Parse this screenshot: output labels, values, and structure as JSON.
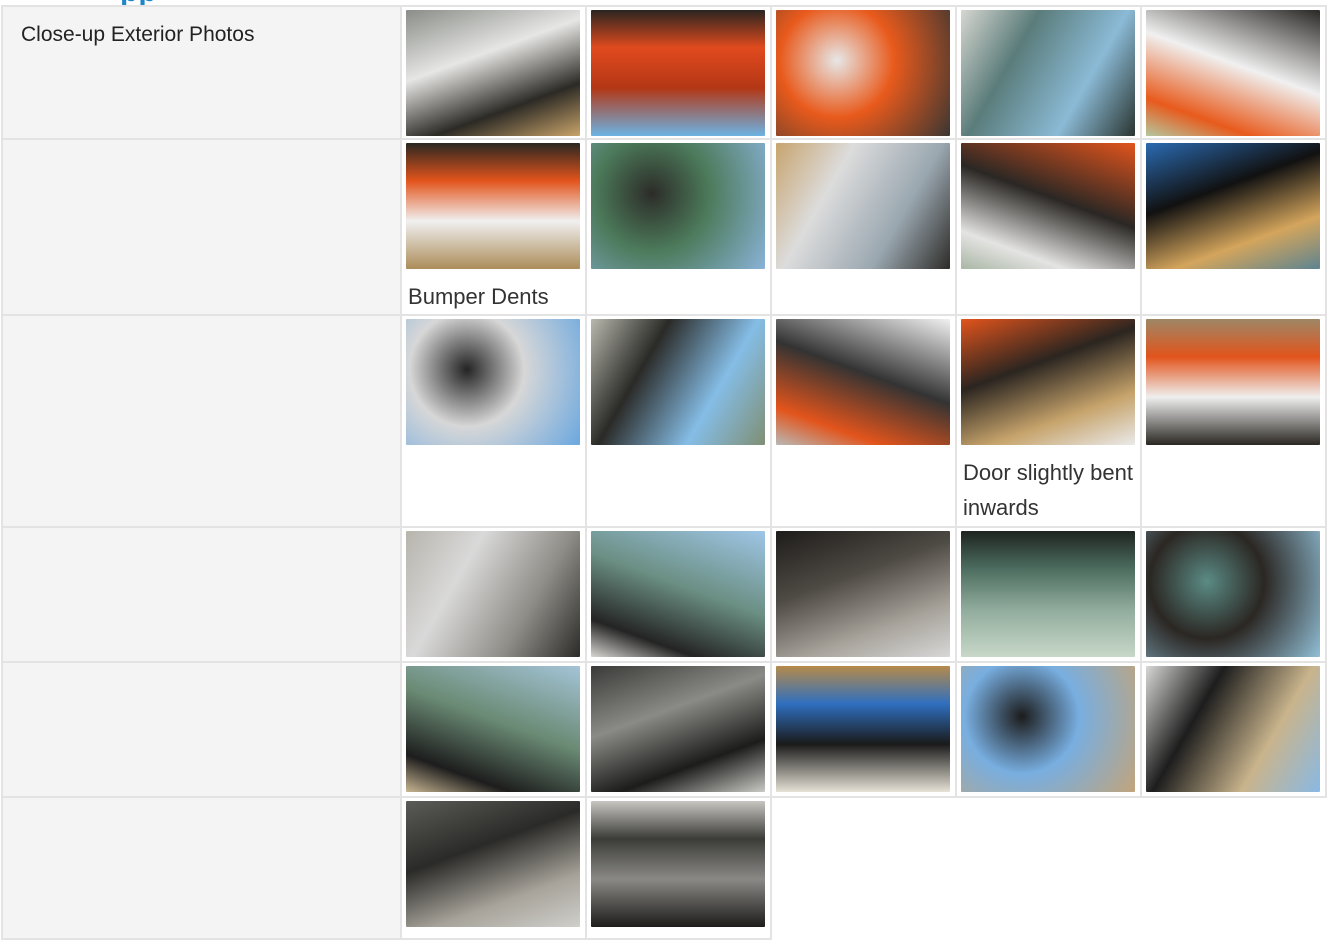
{
  "heading_fragment": "pp",
  "rows": [
    {
      "label": "Close-up Exterior Photos",
      "photos": [
        {
          "caption": "",
          "scene": "white-machine-track-side",
          "colors": [
            "#8a8d88",
            "#e6e6e4",
            "#2c2a25",
            "#c9a46a"
          ]
        },
        {
          "caption": "",
          "scene": "rear-door-open-radiator",
          "colors": [
            "#e14a1e",
            "#b33715",
            "#2a2420",
            "#6db3e3"
          ]
        },
        {
          "caption": "",
          "scene": "orange-rear-bobcat-logo",
          "colors": [
            "#e85a1c",
            "#e7e7e7",
            "#3a3632",
            "#d7ae70"
          ]
        },
        {
          "caption": "",
          "scene": "cab-glass-cage",
          "colors": [
            "#5a7c7a",
            "#2a3530",
            "#8bbad6",
            "#d6d6d0"
          ]
        },
        {
          "caption": "",
          "scene": "orange-side-bobcat-t870",
          "colors": [
            "#e85a1c",
            "#f0f0f0",
            "#2a2825",
            "#b4c7a0"
          ]
        }
      ]
    },
    {
      "label": "",
      "photos": [
        {
          "caption": "Bumper Dents",
          "scene": "rear-bumper-orange",
          "colors": [
            "#e2541c",
            "#f0f0f0",
            "#2a2620",
            "#ac8c59"
          ]
        },
        {
          "caption": "",
          "scene": "cab-side-trees",
          "colors": [
            "#4c7a5a",
            "#2c2c28",
            "#8ab3d8",
            "#bbbbb4"
          ]
        },
        {
          "caption": "",
          "scene": "lift-arm-track-white",
          "colors": [
            "#dcdcdc",
            "#2d2b28",
            "#9aa7b0",
            "#c7a46e"
          ]
        },
        {
          "caption": "",
          "scene": "side-panel-bobcat-t870",
          "colors": [
            "#e4e4e2",
            "#2a2724",
            "#e2541c",
            "#a9b6a5"
          ]
        },
        {
          "caption": "",
          "scene": "cab-front-lights-sky",
          "colors": [
            "#2b6bb2",
            "#111111",
            "#d4a55c",
            "#5d8490"
          ]
        }
      ]
    },
    {
      "label": "",
      "photos": [
        {
          "caption": "",
          "scene": "cab-roof-lift-arm",
          "colors": [
            "#d7d7d7",
            "#242424",
            "#6aa7df",
            "#c4a065"
          ]
        },
        {
          "caption": "",
          "scene": "cab-roof-hill",
          "colors": [
            "#2a2a27",
            "#7f8f74",
            "#85bde6",
            "#b8b8ae"
          ]
        },
        {
          "caption": "",
          "scene": "rear-lights-bobcat",
          "colors": [
            "#e2541c",
            "#333333",
            "#f1f1f1",
            "#b9b9b6"
          ]
        },
        {
          "caption": "Door slightly bent inwards",
          "scene": "rear-door-edge",
          "colors": [
            "#e2541c",
            "#2b2520",
            "#c6a36b",
            "#eaeaea"
          ]
        },
        {
          "caption": "",
          "scene": "bobcat-bumper-ground",
          "colors": [
            "#e2541c",
            "#efefef",
            "#9e8766",
            "#2b2823"
          ]
        }
      ]
    },
    {
      "label": "",
      "photos": [
        {
          "caption": "",
          "scene": "front-underside-white",
          "colors": [
            "#d9d9d9",
            "#2b2b29",
            "#8f8d87",
            "#b7b4ac"
          ]
        },
        {
          "caption": "",
          "scene": "door-open-cab-inside",
          "colors": [
            "#242424",
            "#6b8f83",
            "#9fc6e7",
            "#d8d6d2"
          ]
        },
        {
          "caption": "",
          "scene": "black-panel-closeup",
          "colors": [
            "#1e1c1a",
            "#4e4a44",
            "#a7a39b",
            "#d7d7d7"
          ]
        },
        {
          "caption": "",
          "scene": "green-glass-cage",
          "colors": [
            "#4c6d5f",
            "#90ab9c",
            "#1e2420",
            "#c8d8c8"
          ]
        },
        {
          "caption": "",
          "scene": "door-frame-glass",
          "colors": [
            "#2b2723",
            "#5b8b85",
            "#91bfd6",
            "#d8d4c9"
          ]
        }
      ]
    },
    {
      "label": "",
      "photos": [
        {
          "caption": "",
          "scene": "rear-window-view",
          "colors": [
            "#1d1d1d",
            "#6a8a74",
            "#a4c4d8",
            "#c8b692"
          ]
        },
        {
          "caption": "",
          "scene": "engine-grille-top",
          "colors": [
            "#3a3a38",
            "#8a8a86",
            "#1c1c1b",
            "#c9c9c5"
          ]
        },
        {
          "caption": "",
          "scene": "light-cage-sky",
          "colors": [
            "#2f6fbf",
            "#1a1a1a",
            "#b58a4a",
            "#e7e2d6"
          ]
        },
        {
          "caption": "",
          "scene": "door-open-buildings",
          "colors": [
            "#78aee0",
            "#1c1c1c",
            "#c2a47a",
            "#e3dfd6"
          ]
        },
        {
          "caption": "",
          "scene": "cab-door-yard-view",
          "colors": [
            "#1d1d1d",
            "#89b9e4",
            "#c9b48c",
            "#d8d8d6"
          ]
        }
      ]
    },
    {
      "label": "",
      "photos": [
        {
          "caption": "",
          "scene": "rear-grille-open",
          "colors": [
            "#5b5b57",
            "#2a2a28",
            "#a7a39a",
            "#cfcfcb"
          ]
        },
        {
          "caption": "",
          "scene": "engine-mount-closeup",
          "colors": [
            "#3b3b38",
            "#8a8986",
            "#c7c6c1",
            "#1d1c1a"
          ]
        }
      ]
    }
  ]
}
